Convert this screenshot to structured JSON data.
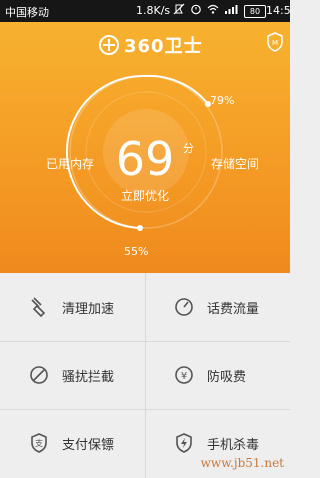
{
  "status_bar": {
    "carrier": "中国移动",
    "rate": "1.8K/s",
    "battery": "80",
    "time": "14:5"
  },
  "header": {
    "logo_text": "360卫士",
    "shield_icon": "shield-icon"
  },
  "gauge": {
    "score": "69",
    "unit": "分",
    "button_label": "立即优化",
    "memory_label": "已用内存",
    "storage_label": "存储空间",
    "storage_percent": "79%",
    "memory_percent": "55%",
    "storage_level": 0.79,
    "memory_level": 0.55
  },
  "features": [
    {
      "label": "清理加速",
      "icon": "broom-icon"
    },
    {
      "label": "话费流量",
      "icon": "gauge-icon"
    },
    {
      "label": "骚扰拦截",
      "icon": "block-icon"
    },
    {
      "label": "防吸费",
      "icon": "yen-icon"
    },
    {
      "label": "支付保镖",
      "icon": "pay-shield-icon"
    },
    {
      "label": "手机杀毒",
      "icon": "antivirus-icon"
    }
  ],
  "watermark": "www.jb51.net",
  "colors": {
    "brand_orange": "#f49a24",
    "bg": "#eeeeee",
    "text": "#333333"
  }
}
